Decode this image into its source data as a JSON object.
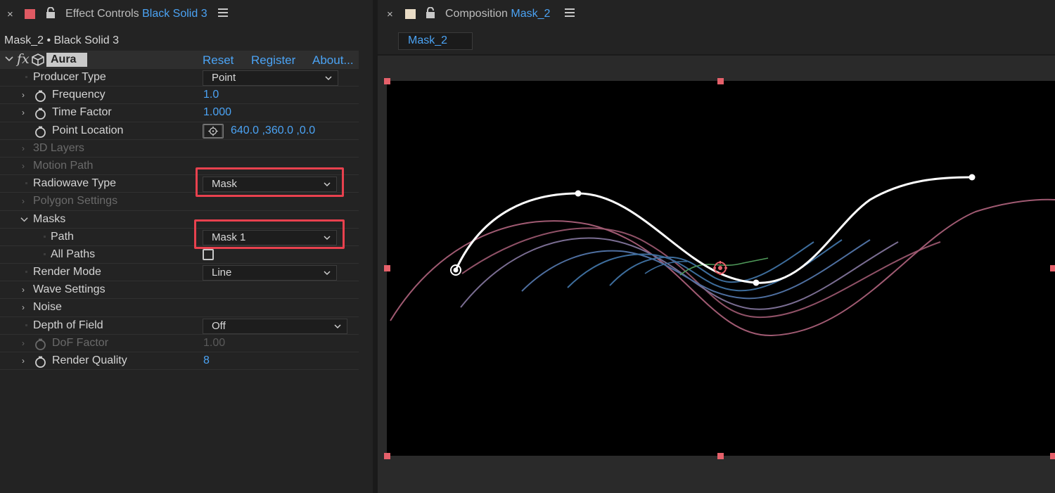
{
  "effect_controls": {
    "close_glyph": "×",
    "title_prefix": "Effect Controls",
    "title_layer": "Black Solid 3",
    "layer_path": "Mask_2 • Black Solid 3",
    "swatch_color": "#e05a63",
    "effect": {
      "fx_glyph": "fx",
      "name": "Aura",
      "reset": "Reset",
      "register": "Register",
      "about": "About..."
    },
    "params": {
      "producer_type": {
        "label": "Producer Type",
        "value": "Point"
      },
      "frequency": {
        "label": "Frequency",
        "value": "1.0"
      },
      "time_factor": {
        "label": "Time Factor",
        "value": "1.000"
      },
      "point_location": {
        "label": "Point Location",
        "value": "640.0 ,360.0 ,0.0"
      },
      "layers_3d": {
        "label": "3D Layers"
      },
      "motion_path": {
        "label": "Motion Path"
      },
      "radiowave_type": {
        "label": "Radiowave Type",
        "value": "Mask"
      },
      "polygon_settings": {
        "label": "Polygon Settings"
      },
      "masks": {
        "label": "Masks"
      },
      "path": {
        "label": "Path",
        "value": "Mask 1"
      },
      "all_paths": {
        "label": "All Paths",
        "checked": false
      },
      "render_mode": {
        "label": "Render Mode",
        "value": "Line"
      },
      "wave_settings": {
        "label": "Wave Settings"
      },
      "noise": {
        "label": "Noise"
      },
      "depth_of_field": {
        "label": "Depth of Field",
        "value": "Off"
      },
      "dof_factor": {
        "label": "DoF Factor",
        "value": "1.00"
      },
      "render_quality": {
        "label": "Render Quality",
        "value": "8"
      }
    }
  },
  "composition": {
    "close_glyph": "×",
    "title_prefix": "Composition",
    "title_comp": "Mask_2",
    "swatch_color": "#e9dcc6",
    "tab_label": "Mask_2"
  },
  "colors": {
    "accent_blue": "#4ba3f4",
    "highlight_red": "#e8414e",
    "mask_path": "#ffffff",
    "wave_pink": "#a05a72",
    "wave_blue": "#3d6d9c",
    "wave_green": "#4f9a5a",
    "handle_red": "#e5606a"
  }
}
